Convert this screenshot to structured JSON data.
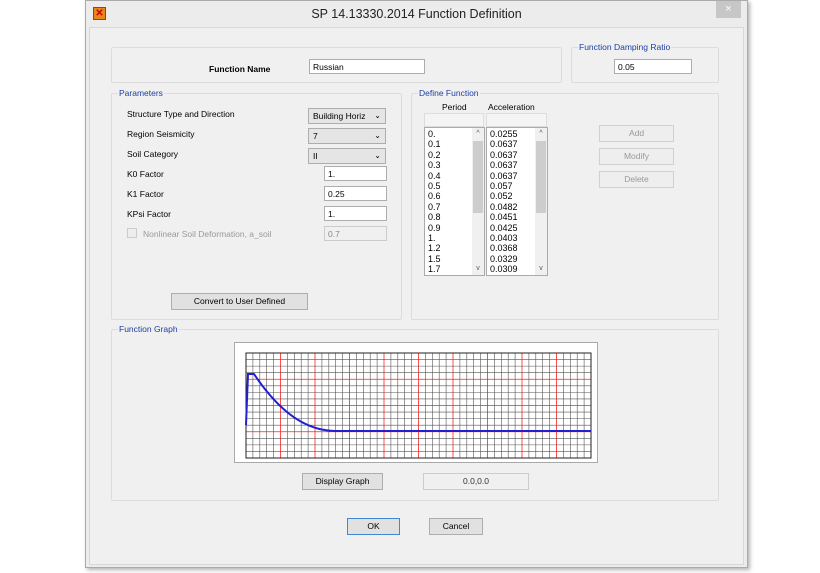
{
  "window": {
    "title": "SP 14.13330.2014 Function Definition",
    "close_label": "×",
    "icon": "app-logo-icon"
  },
  "function_name": {
    "label": "Function Name",
    "value": "Russian"
  },
  "damping": {
    "label": "Function Damping Ratio",
    "value": "0.05"
  },
  "parameters": {
    "label": "Parameters",
    "structure_type": {
      "label": "Structure Type and Direction",
      "value": "Building Horiz"
    },
    "region_seismicity": {
      "label": "Region Seismicity",
      "value": "7"
    },
    "soil_category": {
      "label": "Soil Category",
      "value": "II"
    },
    "k0": {
      "label": "K0 Factor",
      "value": "1."
    },
    "k1": {
      "label": "K1 Factor",
      "value": "0.25"
    },
    "kpsi": {
      "label": "KPsi Factor",
      "value": "1."
    },
    "nonlinear": {
      "label": "Nonlinear Soil Deformation, a_soil",
      "value": "0.7",
      "checked": false
    },
    "convert_label": "Convert to User Defined"
  },
  "define_function": {
    "label": "Define Function",
    "period_header": "Period",
    "acceleration_header": "Acceleration",
    "periods": [
      "0.",
      "0.1",
      "0.2",
      "0.3",
      "0.4",
      "0.5",
      "0.6",
      "0.7",
      "0.8",
      "0.9",
      "1.",
      "1.2",
      "1.5",
      "1.7"
    ],
    "accelerations": [
      "0.0255",
      "0.0637",
      "0.0637",
      "0.0637",
      "0.0637",
      "0.057",
      "0.052",
      "0.0482",
      "0.0451",
      "0.0425",
      "0.0403",
      "0.0368",
      "0.0329",
      "0.0309"
    ],
    "add_label": "Add",
    "modify_label": "Modify",
    "delete_label": "Delete"
  },
  "graph": {
    "label": "Function Graph",
    "display_label": "Display Graph",
    "coords": "0.0,0.0",
    "curve_color": "#2020d0",
    "major_grid_color": "#ff2020",
    "minor_grid_color": "#555555"
  },
  "ok_label": "OK",
  "cancel_label": "Cancel"
}
